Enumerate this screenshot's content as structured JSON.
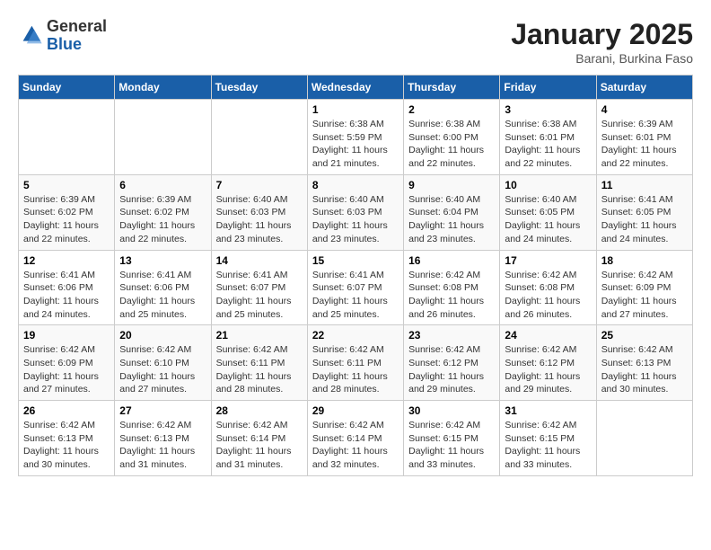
{
  "header": {
    "logo_line1": "General",
    "logo_line2": "Blue",
    "month_title": "January 2025",
    "subtitle": "Barani, Burkina Faso"
  },
  "weekdays": [
    "Sunday",
    "Monday",
    "Tuesday",
    "Wednesday",
    "Thursday",
    "Friday",
    "Saturday"
  ],
  "weeks": [
    [
      null,
      null,
      null,
      {
        "day": "1",
        "sunrise": "6:38 AM",
        "sunset": "5:59 PM",
        "daylight": "11 hours and 21 minutes."
      },
      {
        "day": "2",
        "sunrise": "6:38 AM",
        "sunset": "6:00 PM",
        "daylight": "11 hours and 22 minutes."
      },
      {
        "day": "3",
        "sunrise": "6:38 AM",
        "sunset": "6:01 PM",
        "daylight": "11 hours and 22 minutes."
      },
      {
        "day": "4",
        "sunrise": "6:39 AM",
        "sunset": "6:01 PM",
        "daylight": "11 hours and 22 minutes."
      }
    ],
    [
      {
        "day": "5",
        "sunrise": "6:39 AM",
        "sunset": "6:02 PM",
        "daylight": "11 hours and 22 minutes."
      },
      {
        "day": "6",
        "sunrise": "6:39 AM",
        "sunset": "6:02 PM",
        "daylight": "11 hours and 22 minutes."
      },
      {
        "day": "7",
        "sunrise": "6:40 AM",
        "sunset": "6:03 PM",
        "daylight": "11 hours and 23 minutes."
      },
      {
        "day": "8",
        "sunrise": "6:40 AM",
        "sunset": "6:03 PM",
        "daylight": "11 hours and 23 minutes."
      },
      {
        "day": "9",
        "sunrise": "6:40 AM",
        "sunset": "6:04 PM",
        "daylight": "11 hours and 23 minutes."
      },
      {
        "day": "10",
        "sunrise": "6:40 AM",
        "sunset": "6:05 PM",
        "daylight": "11 hours and 24 minutes."
      },
      {
        "day": "11",
        "sunrise": "6:41 AM",
        "sunset": "6:05 PM",
        "daylight": "11 hours and 24 minutes."
      }
    ],
    [
      {
        "day": "12",
        "sunrise": "6:41 AM",
        "sunset": "6:06 PM",
        "daylight": "11 hours and 24 minutes."
      },
      {
        "day": "13",
        "sunrise": "6:41 AM",
        "sunset": "6:06 PM",
        "daylight": "11 hours and 25 minutes."
      },
      {
        "day": "14",
        "sunrise": "6:41 AM",
        "sunset": "6:07 PM",
        "daylight": "11 hours and 25 minutes."
      },
      {
        "day": "15",
        "sunrise": "6:41 AM",
        "sunset": "6:07 PM",
        "daylight": "11 hours and 25 minutes."
      },
      {
        "day": "16",
        "sunrise": "6:42 AM",
        "sunset": "6:08 PM",
        "daylight": "11 hours and 26 minutes."
      },
      {
        "day": "17",
        "sunrise": "6:42 AM",
        "sunset": "6:08 PM",
        "daylight": "11 hours and 26 minutes."
      },
      {
        "day": "18",
        "sunrise": "6:42 AM",
        "sunset": "6:09 PM",
        "daylight": "11 hours and 27 minutes."
      }
    ],
    [
      {
        "day": "19",
        "sunrise": "6:42 AM",
        "sunset": "6:09 PM",
        "daylight": "11 hours and 27 minutes."
      },
      {
        "day": "20",
        "sunrise": "6:42 AM",
        "sunset": "6:10 PM",
        "daylight": "11 hours and 27 minutes."
      },
      {
        "day": "21",
        "sunrise": "6:42 AM",
        "sunset": "6:11 PM",
        "daylight": "11 hours and 28 minutes."
      },
      {
        "day": "22",
        "sunrise": "6:42 AM",
        "sunset": "6:11 PM",
        "daylight": "11 hours and 28 minutes."
      },
      {
        "day": "23",
        "sunrise": "6:42 AM",
        "sunset": "6:12 PM",
        "daylight": "11 hours and 29 minutes."
      },
      {
        "day": "24",
        "sunrise": "6:42 AM",
        "sunset": "6:12 PM",
        "daylight": "11 hours and 29 minutes."
      },
      {
        "day": "25",
        "sunrise": "6:42 AM",
        "sunset": "6:13 PM",
        "daylight": "11 hours and 30 minutes."
      }
    ],
    [
      {
        "day": "26",
        "sunrise": "6:42 AM",
        "sunset": "6:13 PM",
        "daylight": "11 hours and 30 minutes."
      },
      {
        "day": "27",
        "sunrise": "6:42 AM",
        "sunset": "6:13 PM",
        "daylight": "11 hours and 31 minutes."
      },
      {
        "day": "28",
        "sunrise": "6:42 AM",
        "sunset": "6:14 PM",
        "daylight": "11 hours and 31 minutes."
      },
      {
        "day": "29",
        "sunrise": "6:42 AM",
        "sunset": "6:14 PM",
        "daylight": "11 hours and 32 minutes."
      },
      {
        "day": "30",
        "sunrise": "6:42 AM",
        "sunset": "6:15 PM",
        "daylight": "11 hours and 33 minutes."
      },
      {
        "day": "31",
        "sunrise": "6:42 AM",
        "sunset": "6:15 PM",
        "daylight": "11 hours and 33 minutes."
      },
      null
    ]
  ]
}
